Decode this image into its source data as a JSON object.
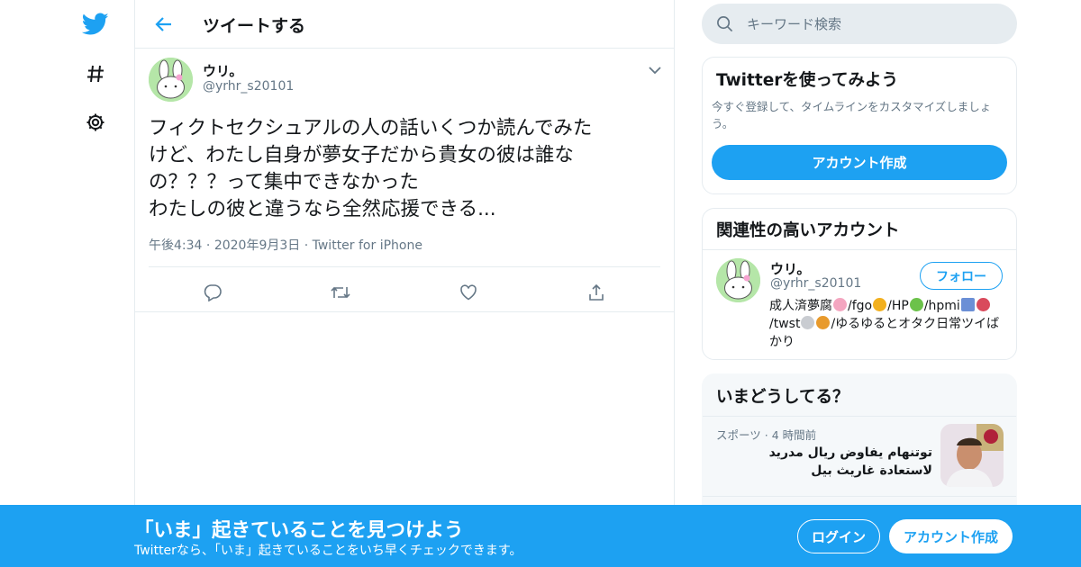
{
  "colors": {
    "accent": "#1da1f2",
    "text": "#14171a",
    "secondary": "#657786",
    "border": "#e6ecf0"
  },
  "nav": {
    "items": [
      {
        "icon": "twitter-logo-icon"
      },
      {
        "icon": "hashtag-icon"
      },
      {
        "icon": "gear-icon"
      }
    ]
  },
  "header": {
    "title": "ツイートする",
    "back_icon": "arrow-left-icon"
  },
  "tweet": {
    "display_name": "ウリ。",
    "handle": "@yrhr_s20101",
    "text": "フィクトセクシュアルの人の話いくつか読んでみた\nけど、わたし自身が夢女子だから貴女の彼は誰な\nの？？？って集中できなかった\nわたしの彼と違うなら全然応援できる...",
    "time": "午後4:34",
    "date": "2020年9月3日",
    "source": "Twitter for iPhone",
    "actions": [
      "reply-icon",
      "retweet-icon",
      "like-icon",
      "share-icon"
    ]
  },
  "search": {
    "placeholder": "キーワード検索"
  },
  "signup": {
    "title": "Twitterを使ってみよう",
    "description": "今すぐ登録して、タイムラインをカスタマイズしましょう。",
    "button": "アカウント作成"
  },
  "related": {
    "title": "関連性の高いアカウント",
    "account": {
      "display_name": "ウリ。",
      "handle": "@yrhr_s20101",
      "follow_label": "フォロー",
      "bio_parts": [
        "成人済夢腐",
        "/fgo",
        "/HP",
        "/hpmi",
        "/twst",
        "/ゆるゆるとオタク日常ツイばかり"
      ]
    }
  },
  "trends": {
    "title": "いまどうしてる？",
    "items": [
      {
        "category": "スポーツ",
        "time": "4 時間前",
        "text": "توتنهام يفاوض ريال مدريد\nلاستعادة غاريث بيل"
      }
    ]
  },
  "bottom_bar": {
    "title": "「いま」起きていることを見つけよう",
    "subtitle": "Twitterなら、「いま」起きていることをいち早くチェックできます。",
    "login": "ログイン",
    "signup": "アカウント作成"
  }
}
